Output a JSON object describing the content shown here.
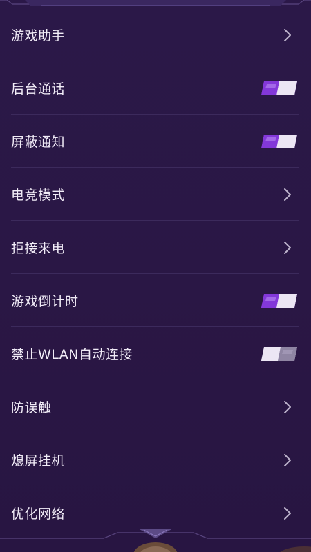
{
  "settings": {
    "items": [
      {
        "label": "游戏助手",
        "control": "chevron"
      },
      {
        "label": "后台通话",
        "control": "toggle",
        "on": true
      },
      {
        "label": "屏蔽通知",
        "control": "toggle",
        "on": true
      },
      {
        "label": "电竞模式",
        "control": "chevron"
      },
      {
        "label": "拒接来电",
        "control": "chevron"
      },
      {
        "label": "游戏倒计时",
        "control": "toggle",
        "on": true
      },
      {
        "label": "禁止WLAN自动连接",
        "control": "toggle",
        "on": false
      },
      {
        "label": "防误触",
        "control": "chevron"
      },
      {
        "label": "熄屏挂机",
        "control": "chevron"
      },
      {
        "label": "优化网络",
        "control": "chevron"
      }
    ]
  },
  "icons": {
    "chevron": "chevron-right-icon",
    "toggle_on": "toggle-on",
    "toggle_off": "toggle-off"
  },
  "colors": {
    "background": "#2a1746",
    "toggle_on_primary": "#9b4ee8",
    "toggle_off_primary": "#c9c0d6",
    "text": "#f1ecf7",
    "chevron": "#bdb3cc"
  }
}
